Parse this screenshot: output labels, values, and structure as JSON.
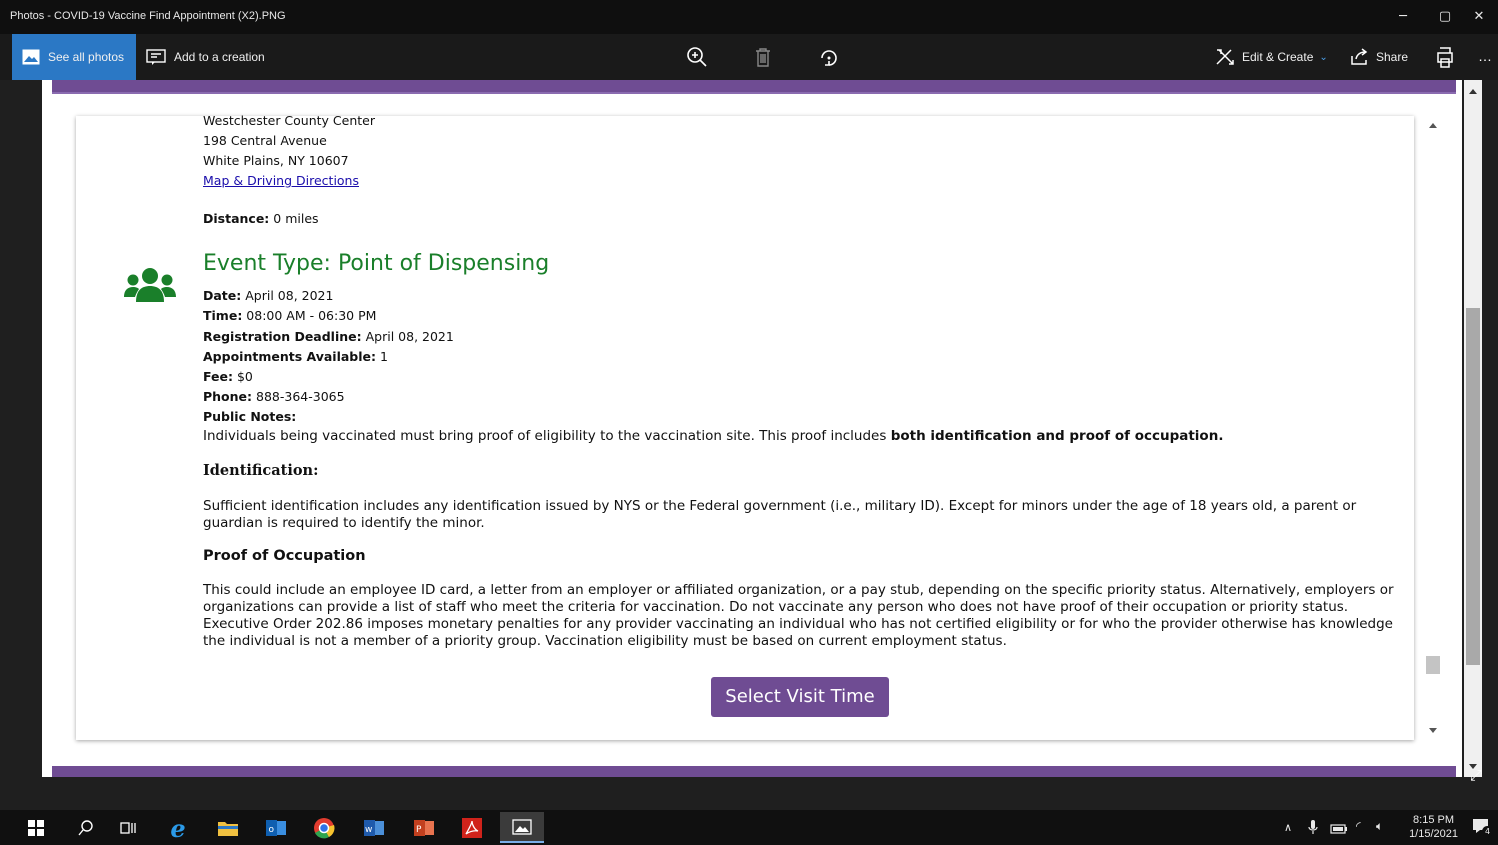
{
  "window": {
    "title": "Photos - COVID-19 Vaccine Find Appointment (X2).PNG"
  },
  "toolbar": {
    "see_all": "See all photos",
    "add_creation": "Add to a creation",
    "edit_create": "Edit & Create",
    "share": "Share"
  },
  "location": {
    "name": "Westchester County Center",
    "street": "198 Central Avenue",
    "city": "White Plains, NY 10607",
    "map_link": "Map & Driving Directions",
    "distance_label": "Distance:",
    "distance_value": " 0 miles"
  },
  "event": {
    "title": "Event Type: Point of Dispensing",
    "date_label": "Date:",
    "date_value": " April 08, 2021",
    "time_label": "Time:",
    "time_value": " 08:00 AM - 06:30 PM",
    "deadline_label": "Registration Deadline:",
    "deadline_value": " April 08, 2021",
    "appointments_label": "Appointments Available:",
    "appointments_value": " 1",
    "fee_label": "Fee:",
    "fee_value": " $0",
    "phone_label": "Phone:",
    "phone_value": " 888-364-3065",
    "notes_label": "Public Notes:",
    "notes_text": "Individuals being vaccinated must bring proof of eligibility to the vaccination site. This proof includes ",
    "notes_bold": "both identification and proof of occupation.",
    "id_heading": "Identification:",
    "id_text": "Sufficient identification includes any identification issued by NYS or the Federal government (i.e., military ID).  Except for minors under the age of 18 years old, a parent or guardian is required to identify the minor.",
    "occ_heading": "Proof of Occupation",
    "occ_text": "This could include an employee ID card, a letter from an employer or affiliated organization, or a pay stub, depending on the specific priority status. Alternatively, employers or organizations can provide a list of staff who meet the criteria for vaccination. Do not vaccinate any person who does not have proof of their occupation or priority status. Executive Order 202.86 imposes monetary penalties for any provider vaccinating an individual who has not certified eligibility or for who the provider otherwise has knowledge the individual is not a member of a priority group. Vaccination eligibility must be based on current employment status.",
    "button": "Select Visit Time"
  },
  "taskbar": {
    "time": "8:15 PM",
    "date": "1/15/2021",
    "notification_count": "4"
  },
  "colors": {
    "accent_purple": "#6f4c93",
    "event_green": "#1a7f2a",
    "photos_blue": "#2b78c5"
  }
}
